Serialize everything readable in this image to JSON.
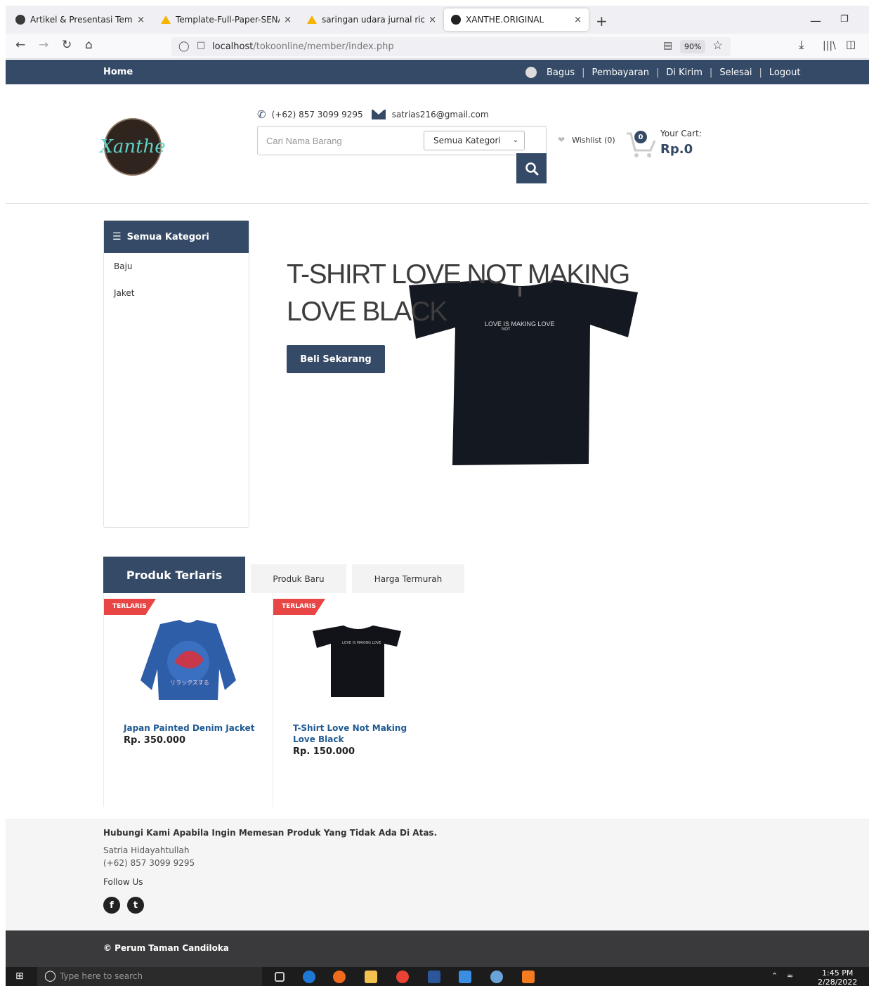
{
  "browser": {
    "tabs": [
      {
        "title": "Artikel & Presentasi Template –",
        "close": "×",
        "color": "#3a3a3a"
      },
      {
        "title": "Template-Full-Paper-SENASAIN",
        "close": "×",
        "color": "#f4b400"
      },
      {
        "title": "saringan udara jurnal rio - Edi",
        "close": "×",
        "color": "#f4b400"
      },
      {
        "title": "XANTHE.ORIGINAL",
        "close": "×",
        "color": "#222222"
      }
    ],
    "new_tab": "+",
    "url_host": "localhost",
    "url_path": "/tokoonline/member/index.php",
    "zoom": "90%"
  },
  "topbar": {
    "home": "Home",
    "user": "Bagus",
    "links": [
      "Pembayaran",
      "Di Kirim",
      "Selesai",
      "Logout"
    ],
    "separator": "|"
  },
  "header": {
    "logo_text": "Xanthe",
    "phone": "(+62) 857 3099 9295",
    "email": "satrias216@gmail.com",
    "search_placeholder": "Cari Nama Barang",
    "category_select": "Semua Kategori",
    "wishlist": "Wishlist (0)",
    "cart_count": "0",
    "cart_label": "Your Cart:",
    "cart_total": "Rp.0"
  },
  "sidebar": {
    "title": "Semua Kategori",
    "items": [
      "Baju",
      "Jaket"
    ]
  },
  "hero": {
    "title_line1": "T-SHIRT LOVE NOT MAKING",
    "title_line2": "LOVE BLACK",
    "button": "Beli Sekarang",
    "shirt_text": "LOVE IS MAKING LOVE",
    "shirt_text_sub": "NOT"
  },
  "product_tabs": {
    "active": "Produk Terlaris",
    "others": [
      "Produk Baru",
      "Harga Termurah"
    ]
  },
  "products": [
    {
      "badge": "TERLARIS",
      "name": "Japan Painted Denim Jacket",
      "price": "Rp. 350.000"
    },
    {
      "badge": "TERLARIS",
      "name": "T-Shirt Love Not Making Love Black",
      "price": "Rp. 150.000"
    }
  ],
  "jacket_art_text": "リラックスする",
  "footer": {
    "title": "Hubungi Kami Apabila Ingin Memesan Produk Yang Tidak Ada Di Atas.",
    "name": "Satria Hidayahtullah",
    "phone": "(+62) 857 3099 9295",
    "follow": "Follow Us",
    "facebook": "f",
    "twitter": "t",
    "copyright": "© Perum Taman Candiloka"
  },
  "taskbar": {
    "search_placeholder": "Type here to search",
    "time": "1:45 PM",
    "date": "2/28/2022"
  },
  "colors": {
    "primary": "#354a66",
    "badge": "#e84545",
    "link": "#1f5a93"
  }
}
